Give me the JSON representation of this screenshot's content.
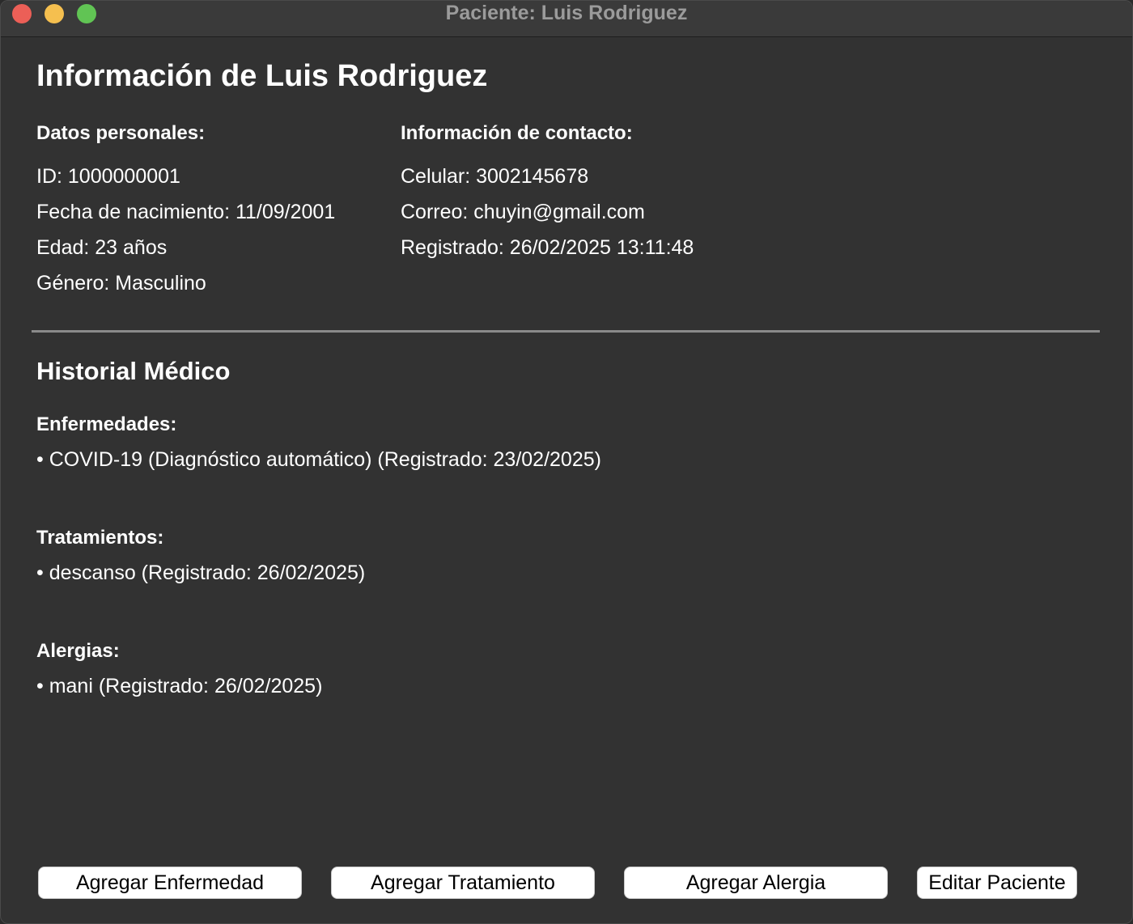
{
  "window": {
    "title": "Paciente: Luis Rodriguez"
  },
  "heading": "Información de Luis Rodriguez",
  "personal": {
    "title": "Datos personales:",
    "lines": [
      "ID: 1000000001",
      "Fecha de nacimiento: 11/09/2001",
      "Edad: 23 años",
      "Género: Masculino"
    ]
  },
  "contact": {
    "title": "Información de contacto:",
    "lines": [
      "Celular: 3002145678",
      "Correo: chuyin@gmail.com",
      "Registrado: 26/02/2025 13:11:48"
    ]
  },
  "history": {
    "title": "Historial Médico",
    "diseases": {
      "title": "Enfermedades:",
      "items": [
        "• COVID-19 (Diagnóstico automático) (Registrado: 23/02/2025)"
      ]
    },
    "treatments": {
      "title": "Tratamientos:",
      "items": [
        "• descanso (Registrado: 26/02/2025)"
      ]
    },
    "allergies": {
      "title": "Alergias:",
      "items": [
        "• mani (Registrado: 26/02/2025)"
      ]
    }
  },
  "buttons": {
    "add_disease": "Agregar Enfermedad",
    "add_treatment": "Agregar Tratamiento",
    "add_allergy": "Agregar Alergia",
    "edit_patient": "Editar Paciente"
  },
  "colors": {
    "background": "#323232",
    "titlebar": "#3a3a3a",
    "text": "#ffffff",
    "title_text": "#9b9b9b",
    "close": "#ec5f57",
    "minimize": "#f5bf4f",
    "maximize": "#61c454"
  }
}
